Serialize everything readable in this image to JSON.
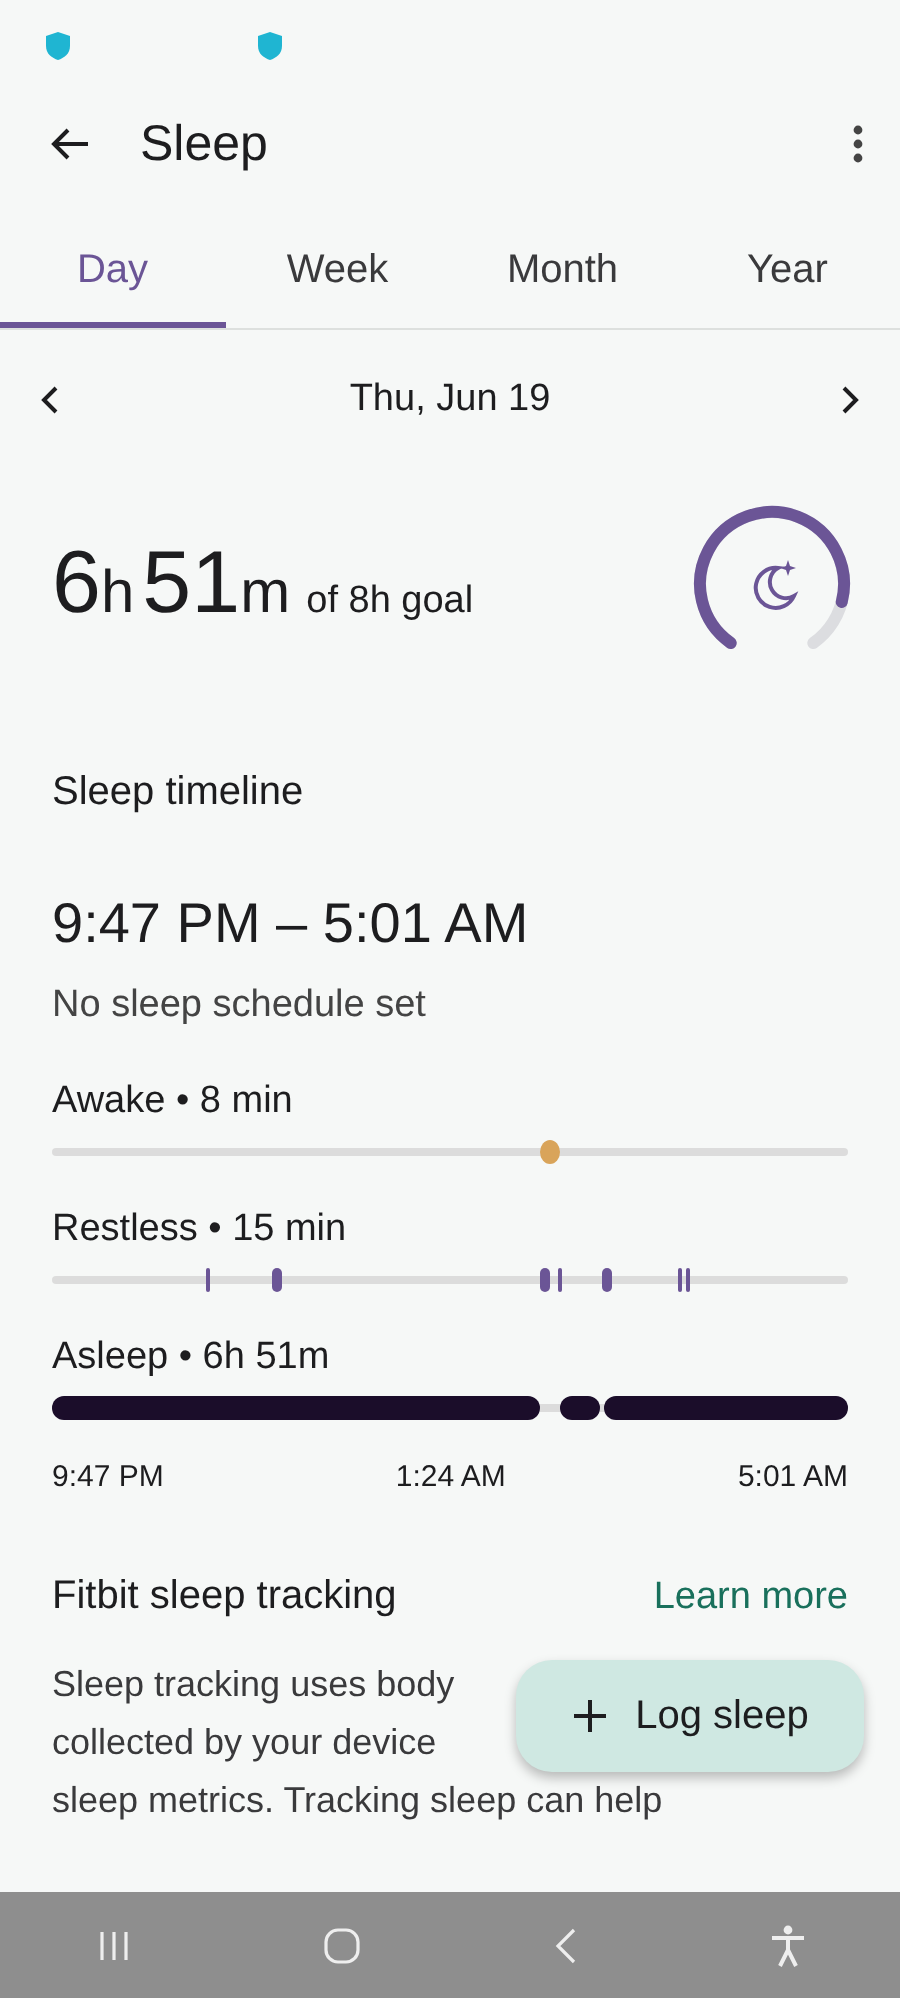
{
  "app_bar": {
    "title": "Sleep"
  },
  "tabs": [
    {
      "label": "Day",
      "selected": true
    },
    {
      "label": "Week",
      "selected": false
    },
    {
      "label": "Month",
      "selected": false
    },
    {
      "label": "Year",
      "selected": false
    }
  ],
  "date": "Thu, Jun 19",
  "summary": {
    "hours": "6",
    "hours_unit": "h",
    "minutes": "51",
    "minutes_unit": "m",
    "goal": "of 8h goal",
    "level": 0.86
  },
  "timeline": {
    "title": "Sleep timeline",
    "range": "9:47 PM – 5:01 AM",
    "schedule": "No sleep schedule set",
    "stages": [
      {
        "kind": "awake",
        "label": "Awake • 8 min"
      },
      {
        "kind": "restless",
        "label": "Restless • 15 min"
      },
      {
        "kind": "asleep",
        "label": "Asleep • 6h 51m"
      }
    ],
    "axis": [
      "9:47 PM",
      "1:24 AM",
      "5:01 AM"
    ]
  },
  "tracking": {
    "title": "Fitbit sleep tracking",
    "link": "Learn more",
    "lines": [
      "Sleep tracking uses body",
      "collected by your device",
      "sleep metrics. Tracking sleep can help"
    ]
  },
  "fab": {
    "label": "Log sleep"
  }
}
